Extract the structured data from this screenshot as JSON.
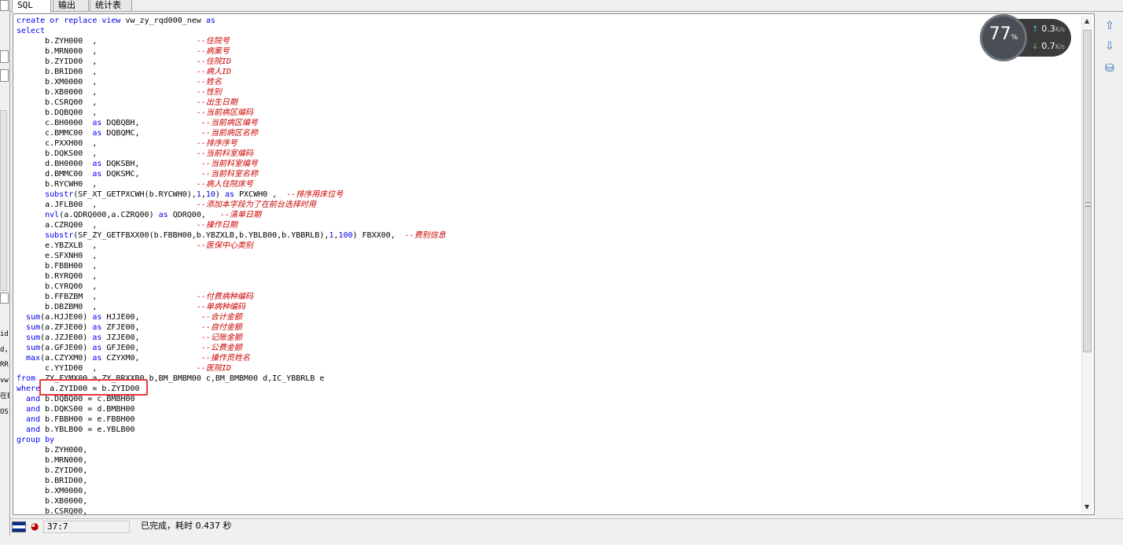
{
  "tabs": [
    {
      "label": "SQL",
      "active": true
    },
    {
      "label": "输出",
      "active": false
    },
    {
      "label": "统计表",
      "active": false
    }
  ],
  "left_strip": {
    "texts": [
      "id",
      "d,",
      "RR",
      "vw",
      "在E",
      "OS"
    ]
  },
  "code_lines": [
    [
      {
        "t": "create or replace view ",
        "c": "kw"
      },
      {
        "t": "vw_zy_rqd000_new ",
        "c": "nm"
      },
      {
        "t": "as",
        "c": "kw"
      }
    ],
    [
      {
        "t": "select",
        "c": "kw"
      }
    ],
    [
      {
        "t": "      b.ZYH000  ,                     ",
        "c": "nm"
      },
      {
        "t": "--住院号",
        "c": "cm"
      }
    ],
    [
      {
        "t": "      b.MRN000  ,                     ",
        "c": "nm"
      },
      {
        "t": "--病案号",
        "c": "cm"
      }
    ],
    [
      {
        "t": "      b.ZYID00  ,                     ",
        "c": "nm"
      },
      {
        "t": "--住院ID",
        "c": "cm"
      }
    ],
    [
      {
        "t": "      b.BRID00  ,                     ",
        "c": "nm"
      },
      {
        "t": "--病人ID",
        "c": "cm"
      }
    ],
    [
      {
        "t": "      b.XM0000  ,                     ",
        "c": "nm"
      },
      {
        "t": "--姓名",
        "c": "cm"
      }
    ],
    [
      {
        "t": "      b.XB0000  ,                     ",
        "c": "nm"
      },
      {
        "t": "--性别",
        "c": "cm"
      }
    ],
    [
      {
        "t": "      b.CSRQ00  ,                     ",
        "c": "nm"
      },
      {
        "t": "--出生日期",
        "c": "cm"
      }
    ],
    [
      {
        "t": "      b.DQBQ00  ,                     ",
        "c": "nm"
      },
      {
        "t": "--当前病区编码",
        "c": "cm"
      }
    ],
    [
      {
        "t": "      c.BH0000  ",
        "c": "nm"
      },
      {
        "t": "as",
        "c": "kw"
      },
      {
        "t": " DQBQBH,             ",
        "c": "nm"
      },
      {
        "t": "--当前病区编号",
        "c": "cm"
      }
    ],
    [
      {
        "t": "      c.BMMC00  ",
        "c": "nm"
      },
      {
        "t": "as",
        "c": "kw"
      },
      {
        "t": " DQBQMC,             ",
        "c": "nm"
      },
      {
        "t": "--当前病区名称",
        "c": "cm"
      }
    ],
    [
      {
        "t": "      c.PXXH00  ,                     ",
        "c": "nm"
      },
      {
        "t": "--排序序号",
        "c": "cm"
      }
    ],
    [
      {
        "t": "      b.DQKS00  ,                     ",
        "c": "nm"
      },
      {
        "t": "--当前科室编码",
        "c": "cm"
      }
    ],
    [
      {
        "t": "      d.BH0000  ",
        "c": "nm"
      },
      {
        "t": "as",
        "c": "kw"
      },
      {
        "t": " DQKSBH,             ",
        "c": "nm"
      },
      {
        "t": "--当前科室编号",
        "c": "cm"
      }
    ],
    [
      {
        "t": "      d.BMMC00  ",
        "c": "nm"
      },
      {
        "t": "as",
        "c": "kw"
      },
      {
        "t": " DQKSMC,             ",
        "c": "nm"
      },
      {
        "t": "--当前科室名称",
        "c": "cm"
      }
    ],
    [
      {
        "t": "      b.RYCWH0  ,                     ",
        "c": "nm"
      },
      {
        "t": "--病人住院床号",
        "c": "cm"
      }
    ],
    [
      {
        "t": "      ",
        "c": "nm"
      },
      {
        "t": "substr",
        "c": "fn"
      },
      {
        "t": "(SF_XT_GETPXCWH(b.RYCWH0),",
        "c": "nm"
      },
      {
        "t": "1",
        "c": "kw"
      },
      {
        "t": ",",
        "c": "nm"
      },
      {
        "t": "10",
        "c": "kw"
      },
      {
        "t": ") ",
        "c": "nm"
      },
      {
        "t": "as",
        "c": "kw"
      },
      {
        "t": " PXCWH0 ,  ",
        "c": "nm"
      },
      {
        "t": "--排序用床位号",
        "c": "cm"
      }
    ],
    [
      {
        "t": "      a.JFLB00  ,                     ",
        "c": "nm"
      },
      {
        "t": "--添加本字段为了在前台选择时用",
        "c": "cm"
      }
    ],
    [
      {
        "t": "      ",
        "c": "nm"
      },
      {
        "t": "nvl",
        "c": "fn"
      },
      {
        "t": "(a.QDRQ000,a.CZRQ00) ",
        "c": "nm"
      },
      {
        "t": "as",
        "c": "kw"
      },
      {
        "t": " QDRQ00,   ",
        "c": "nm"
      },
      {
        "t": "--清单日期",
        "c": "cm"
      }
    ],
    [
      {
        "t": "      a.CZRQ00  ,                     ",
        "c": "nm"
      },
      {
        "t": "--操作日期",
        "c": "cm"
      }
    ],
    [
      {
        "t": "      ",
        "c": "nm"
      },
      {
        "t": "substr",
        "c": "fn"
      },
      {
        "t": "(SF_ZY_GETFBXX00(b.FBBH00,b.YBZXLB,b.YBLB00,b.YBBRLB),",
        "c": "nm"
      },
      {
        "t": "1",
        "c": "kw"
      },
      {
        "t": ",",
        "c": "nm"
      },
      {
        "t": "100",
        "c": "kw"
      },
      {
        "t": ") FBXX00,  ",
        "c": "nm"
      },
      {
        "t": "--费别信息",
        "c": "cm"
      }
    ],
    [
      {
        "t": "      e.YBZXLB  ,                     ",
        "c": "nm"
      },
      {
        "t": "--医保中心类别",
        "c": "cm"
      }
    ],
    [
      {
        "t": "      e.SFXNH0  ,",
        "c": "nm"
      }
    ],
    [
      {
        "t": "      b.FBBH00  ,",
        "c": "nm"
      }
    ],
    [
      {
        "t": "      b.RYRQ00  ,",
        "c": "nm"
      }
    ],
    [
      {
        "t": "      b.CYRQ00  ,",
        "c": "nm"
      }
    ],
    [
      {
        "t": "      b.FFBZBM  ,                     ",
        "c": "nm"
      },
      {
        "t": "--付费病种编码",
        "c": "cm"
      }
    ],
    [
      {
        "t": "      b.DBZBM0  ,                     ",
        "c": "nm"
      },
      {
        "t": "--单病种编码",
        "c": "cm"
      }
    ],
    [
      {
        "t": "  ",
        "c": "nm"
      },
      {
        "t": "sum",
        "c": "fn"
      },
      {
        "t": "(a.HJJE00) ",
        "c": "nm"
      },
      {
        "t": "as",
        "c": "kw"
      },
      {
        "t": " HJJE00,             ",
        "c": "nm"
      },
      {
        "t": "--合计金额",
        "c": "cm"
      }
    ],
    [
      {
        "t": "  ",
        "c": "nm"
      },
      {
        "t": "sum",
        "c": "fn"
      },
      {
        "t": "(a.ZFJE00) ",
        "c": "nm"
      },
      {
        "t": "as",
        "c": "kw"
      },
      {
        "t": " ZFJE00,             ",
        "c": "nm"
      },
      {
        "t": "--自付金额",
        "c": "cm"
      }
    ],
    [
      {
        "t": "  ",
        "c": "nm"
      },
      {
        "t": "sum",
        "c": "fn"
      },
      {
        "t": "(a.JZJE00) ",
        "c": "nm"
      },
      {
        "t": "as",
        "c": "kw"
      },
      {
        "t": " JZJE00,             ",
        "c": "nm"
      },
      {
        "t": "--记账金额",
        "c": "cm"
      }
    ],
    [
      {
        "t": "  ",
        "c": "nm"
      },
      {
        "t": "sum",
        "c": "fn"
      },
      {
        "t": "(a.GFJE00) ",
        "c": "nm"
      },
      {
        "t": "as",
        "c": "kw"
      },
      {
        "t": " GFJE00,             ",
        "c": "nm"
      },
      {
        "t": "--公费金额",
        "c": "cm"
      }
    ],
    [
      {
        "t": "  ",
        "c": "nm"
      },
      {
        "t": "max",
        "c": "fn"
      },
      {
        "t": "(a.CZYXM0) ",
        "c": "nm"
      },
      {
        "t": "as",
        "c": "kw"
      },
      {
        "t": " CZYXM0,             ",
        "c": "nm"
      },
      {
        "t": "--操作员姓名",
        "c": "cm"
      }
    ],
    [
      {
        "t": "      c.YYID00  ,                     ",
        "c": "nm"
      },
      {
        "t": "--医院ID",
        "c": "cm"
      }
    ],
    [
      {
        "t": "from",
        "c": "kw"
      },
      {
        "t": "  ZY_FYMX00 a,ZY_BRXXB0 b,BM_BMBM00 c,BM_BMBM00 d,IC_YBBRLB e",
        "c": "nm"
      }
    ],
    [
      {
        "t": "where",
        "c": "kw"
      },
      {
        "t": "  a.ZYID00 = b.ZYID00",
        "c": "nm"
      }
    ],
    [
      {
        "t": "  and",
        "c": "kw"
      },
      {
        "t": " b.DQBQ00 = c.BMBH00",
        "c": "nm"
      }
    ],
    [
      {
        "t": "  and",
        "c": "kw"
      },
      {
        "t": " b.DQKS00 = d.BMBH00",
        "c": "nm"
      }
    ],
    [
      {
        "t": "  and",
        "c": "kw"
      },
      {
        "t": " b.FBBH00 = e.FBBH00",
        "c": "nm"
      }
    ],
    [
      {
        "t": "  and",
        "c": "kw"
      },
      {
        "t": " b.YBLB00 = e.YBLB00",
        "c": "nm"
      }
    ],
    [
      {
        "t": "group by",
        "c": "kw"
      }
    ],
    [
      {
        "t": "      b.ZYH000,",
        "c": "nm"
      }
    ],
    [
      {
        "t": "      b.MRN000,",
        "c": "nm"
      }
    ],
    [
      {
        "t": "      b.ZYID00,",
        "c": "nm"
      }
    ],
    [
      {
        "t": "      b.BRID00,",
        "c": "nm"
      }
    ],
    [
      {
        "t": "      b.XM0000,",
        "c": "nm"
      }
    ],
    [
      {
        "t": "      b.XB0000,",
        "c": "nm"
      }
    ],
    [
      {
        "t": "      b.CSRQ00,",
        "c": "nm"
      }
    ]
  ],
  "net_widget": {
    "cpu_percent": "77",
    "percent_sign": "%",
    "upload": "0.3",
    "download": "0.7",
    "unit": "K/s"
  },
  "status": {
    "cursor": "37:7",
    "message": "已完成，耗时 0.437 秒"
  },
  "colors": {
    "keyword": "#0000ee",
    "comment": "#cc0000",
    "highlight_box": "#e53935"
  }
}
